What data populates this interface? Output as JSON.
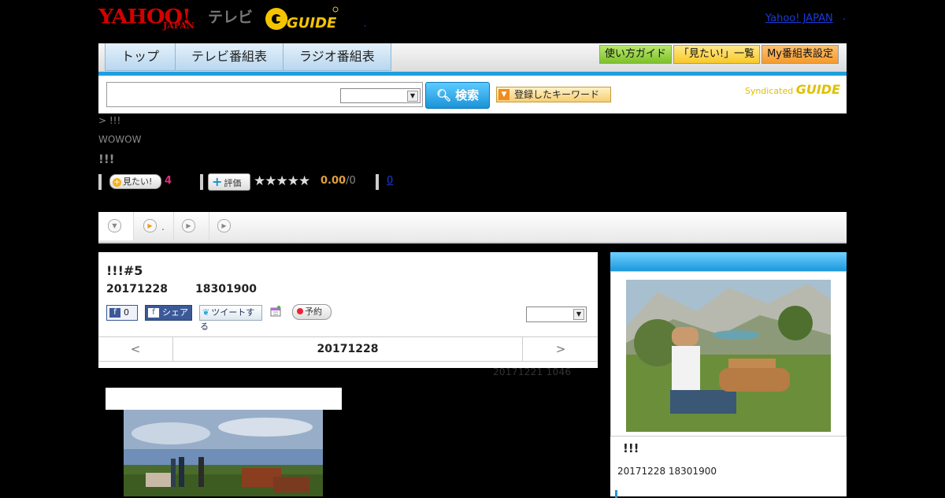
{
  "header": {
    "logo_yahoo": "YAHOO!",
    "logo_japan": "JAPAN",
    "logo_tv": "テレビ",
    "logo_gguide": "G-GUIDE",
    "yahoo_japan_link": "Yahoo! JAPAN",
    "separator": ".",
    "tiny_link": ","
  },
  "nav": {
    "tabs": [
      "トップ",
      "テレビ番組表",
      "ラジオ番組表"
    ],
    "buttons": [
      "使い方ガイド",
      "「見たい!」一覧",
      "My番組表設定"
    ]
  },
  "search": {
    "input_value": "",
    "select_value": "",
    "search_button": "検索",
    "keyword_button": "登録したキーワード",
    "syndicated": "Syndicated",
    "syndicated_g": "GUIDE"
  },
  "program": {
    "breadcrumb": "> !!!",
    "channel": "WOWOW",
    "title": "!!!"
  },
  "stats": {
    "mitai_label": "見たい!",
    "mitai_count": "4",
    "hyouka_label": "評価",
    "stars": "★★★★★",
    "score": "0.00",
    "score_count": "/0",
    "link_count": "0"
  },
  "tabstrip": {
    "tab2_label": "."
  },
  "episode": {
    "title": "!!!#5",
    "date": "20171228",
    "time": "18301900",
    "fb_like_count": "0",
    "fb_share": "シェア",
    "tweet": "ツイートする",
    "reserve": "予約",
    "prev": "<",
    "next": ">",
    "nav_date": "20171228",
    "updated": "20171221  1046"
  },
  "side": {
    "title": "!!!",
    "date": "20171228  18301900"
  },
  "colors": {
    "accent_blue": "#1ea0e0",
    "yahoo_red": "#d50000",
    "gguide_yellow": "#f5c400",
    "pink_count": "#e02a7a",
    "score_orange": "#e0a040"
  }
}
